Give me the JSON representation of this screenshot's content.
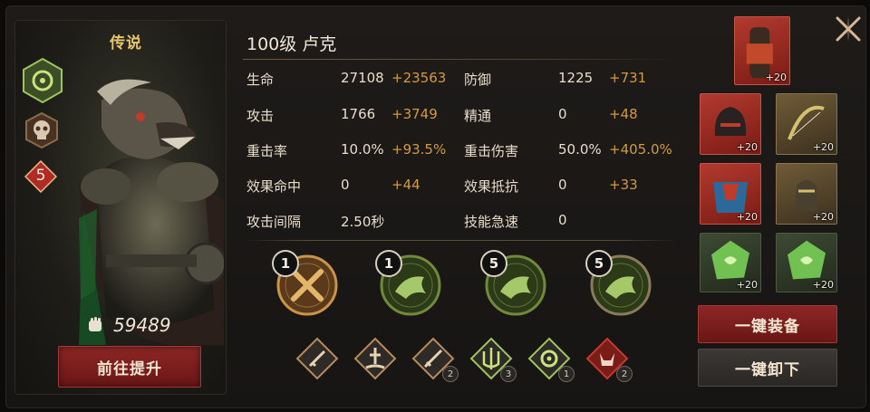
{
  "hero": {
    "rarity": "传说",
    "title": "100级 卢克",
    "power": "59489",
    "upgrade_label": "前往提升",
    "star_rank": "5"
  },
  "stats": [
    {
      "label": "生命",
      "value": "27108",
      "bonus": "+23563"
    },
    {
      "label": "防御",
      "value": "1225",
      "bonus": "+731"
    },
    {
      "label": "攻击",
      "value": "1766",
      "bonus": "+3749"
    },
    {
      "label": "精通",
      "value": "0",
      "bonus": "+48"
    },
    {
      "label": "重击率",
      "value": "10.0%",
      "bonus": "+93.5%"
    },
    {
      "label": "重击伤害",
      "value": "50.0%",
      "bonus": "+405.0%"
    },
    {
      "label": "效果命中",
      "value": "0",
      "bonus": "+44"
    },
    {
      "label": "效果抵抗",
      "value": "0",
      "bonus": "+33"
    },
    {
      "label": "攻击间隔",
      "value": "2.50秒",
      "bonus": ""
    },
    {
      "label": "技能急速",
      "value": "0",
      "bonus": ""
    }
  ],
  "skills": [
    {
      "level": "1",
      "icon": "crossed-swords-icon"
    },
    {
      "level": "1",
      "icon": "beast-lunge-icon"
    },
    {
      "level": "5",
      "icon": "rat-pounce-icon"
    },
    {
      "level": "5",
      "icon": "rat-roar-icon"
    }
  ],
  "runes": [
    {
      "icon": "sword-rune-icon",
      "count": ""
    },
    {
      "icon": "sword-altar-rune-icon",
      "count": ""
    },
    {
      "icon": "dagger-rune-icon",
      "count": "2"
    },
    {
      "icon": "trident-rune-icon",
      "count": "3"
    },
    {
      "icon": "swirl-rune-icon",
      "count": "1"
    },
    {
      "icon": "demon-rune-icon",
      "count": "2"
    }
  ],
  "equipment": [
    {
      "name": "gauntlet-top",
      "plus": "+20"
    },
    {
      "name": "helmet",
      "plus": "+20"
    },
    {
      "name": "bow",
      "plus": "+20"
    },
    {
      "name": "armor",
      "plus": "+20"
    },
    {
      "name": "glove",
      "plus": "+20"
    },
    {
      "name": "green-gem-1",
      "plus": "+20"
    },
    {
      "name": "green-gem-2",
      "plus": "+20"
    }
  ],
  "buttons": {
    "equip_all": "一键装备",
    "unequip_all": "一键卸下"
  },
  "colors": {
    "gold": "#e8c46a",
    "bonus": "#d39a3e",
    "primary_red": "#8d2626"
  }
}
